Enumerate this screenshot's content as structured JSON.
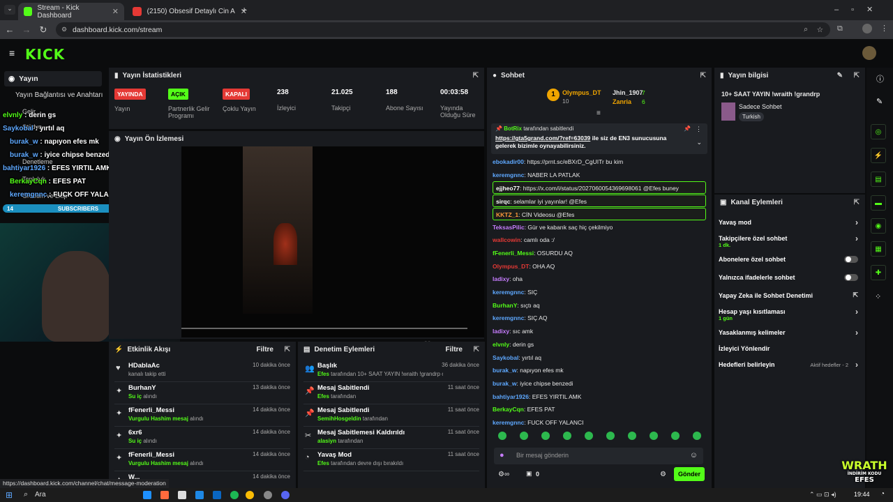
{
  "browser": {
    "tabs": [
      {
        "label": "Stream - Kick Dashboard"
      },
      {
        "label": "(2150) Obsesif Detaylı Cin Alem"
      }
    ],
    "url": "dashboard.kick.com/stream",
    "status_url": "https://dashboard.kick.com/channel/chat/message-moderation"
  },
  "brand": {
    "logo": "KICK",
    "accent": "#53fc18"
  },
  "left_nav": {
    "title": "Yayın",
    "items": [
      "Yayın Bağlantısı ve Anahtarı",
      "Gelir",
      "Stüdyo",
      "Denetleme",
      "Topluluk",
      "Grubum ve Ekip"
    ]
  },
  "stream_stats": {
    "title": "Yayın İstatistikleri",
    "items": [
      {
        "badge": "YAYINDA",
        "label": "Yayın",
        "badge_color": "#e53935"
      },
      {
        "badge": "AÇIK",
        "label": "Partnerlik Gelir Programı",
        "badge_color": "#53fc18"
      },
      {
        "badge": "KAPALI",
        "label": "Çoklu Yayın",
        "badge_color": "#e53935"
      },
      {
        "value": "238",
        "label": "İzleyici"
      },
      {
        "value": "21.025",
        "label": "Takipçi"
      },
      {
        "value": "188",
        "label": "Abone Sayısı"
      },
      {
        "value": "00:03:58",
        "label": "Yayında Olduğu Süre"
      }
    ]
  },
  "preview": {
    "title": "Yayın Ön İzlemesi"
  },
  "activity": {
    "title": "Etkinlik Akışı",
    "filter": "Filtre",
    "rows": [
      {
        "icon": "heart-icon",
        "glyph": "♥",
        "name": "HDablaAc",
        "sub": "kanalı takip etti",
        "hl": "",
        "time": "10 dakika önce"
      },
      {
        "icon": "redeem-icon",
        "glyph": "✦",
        "name": "BurhanY",
        "hl": "Su iç",
        "sub": "alındı",
        "time": "13 dakika önce"
      },
      {
        "icon": "redeem-icon",
        "glyph": "✦",
        "name": "fFenerli_Messi",
        "hl": "Vurgulu Hashim mesaj",
        "sub": "alındı",
        "time": "14 dakika önce"
      },
      {
        "icon": "redeem-icon",
        "glyph": "✦",
        "name": "6xr6",
        "hl": "Su iç",
        "sub": "alındı",
        "time": "14 dakika önce"
      },
      {
        "icon": "redeem-icon",
        "glyph": "✦",
        "name": "fFenerli_Messi",
        "hl": "Vurgulu Hashim mesaj",
        "sub": "alındı",
        "time": "14 dakika önce"
      },
      {
        "icon": "redeem-icon",
        "glyph": "✦",
        "name": "W...",
        "hl": "",
        "sub": "",
        "time": "14 dakika önce"
      }
    ]
  },
  "moderation": {
    "title": "Denetim Eylemleri",
    "filter": "Filtre",
    "rows": [
      {
        "icon": "title-icon",
        "glyph": "👥",
        "name": "Başlık",
        "hl": "Efes",
        "sub": "tarafından 10+ SAAT YAYIN !wraith !grandrp olarak değiştirildi",
        "time": "36 dakika önce"
      },
      {
        "icon": "pin-icon",
        "glyph": "📌",
        "name": "Mesaj Sabitlendi",
        "hl": "Efes",
        "sub": "tarafından",
        "time": "11 saat önce"
      },
      {
        "icon": "pin-icon",
        "glyph": "📌",
        "name": "Mesaj Sabitlendi",
        "hl": "SemihHosgeldin",
        "sub": "tarafından",
        "time": "11 saat önce"
      },
      {
        "icon": "unpin-icon",
        "glyph": "✂",
        "name": "Mesaj Sabitlemesi Kaldırıldı",
        "hl": "alasiyn",
        "sub": "tarafından",
        "time": "11 saat önce"
      },
      {
        "icon": "slow-mode-icon",
        "glyph": "◔",
        "name": "Yavaş Mod",
        "hl": "Efes",
        "sub": "tarafından devre dışı bırakıldı",
        "time": "11 saat önce"
      }
    ]
  },
  "chat": {
    "title": "Sohbet",
    "leaders": [
      {
        "name": "Olympus_DT",
        "count": "10"
      },
      {
        "name": "Jhin_1907",
        "count": "7"
      },
      {
        "name": "Zanria",
        "count": "6"
      }
    ],
    "pinned": {
      "by": "BotRix",
      "by_suffix": "tarafından sabitlendi",
      "link": "https://gta5grand.com/?ref=63039",
      "text": "ile siz de EN3 sunucusuna gelerek bizimle oynayabilirsiniz."
    },
    "messages": [
      {
        "user": "ebokadir00",
        "color": "#5ea8ff",
        "text": "https://prnt.sc/eBXrD_CgUITr bu kim",
        "boxed": false
      },
      {
        "user": "keremgnnc",
        "color": "#5ea8ff",
        "text": "NABER LA PATLAK",
        "boxed": false
      },
      {
        "user": "ejjheo77",
        "color": "#ffffff",
        "text": "https://x.com/i/status/2027060054369698061 @Efes buney",
        "boxed": true
      },
      {
        "user": "sirqc",
        "color": "#ffffff",
        "text": "selamlar iyi yayınlar! @Efes",
        "boxed": true
      },
      {
        "user": "KKTZ_1",
        "color": "#ff9a3c",
        "text": "CİN Videosu @Efes",
        "boxed": true
      },
      {
        "user": "TeksasPilic",
        "color": "#c77dff",
        "text": "Gür ve kabarık saç hiç çekilmiyo",
        "boxed": false
      },
      {
        "user": "wallcowin",
        "color": "#e53935",
        "text": "camlı oda :/",
        "boxed": false
      },
      {
        "user": "fFenerli_Messi",
        "color": "#53fc18",
        "text": "OSURDU AQ",
        "boxed": false
      },
      {
        "user": "Olympus_DT",
        "color": "#e53935",
        "text": "OHA AQ",
        "boxed": false
      },
      {
        "user": "ladixy",
        "color": "#c77dff",
        "text": "oha",
        "boxed": false
      },
      {
        "user": "keremgnnc",
        "color": "#5ea8ff",
        "text": "SIÇ",
        "boxed": false
      },
      {
        "user": "BurhanY",
        "color": "#53fc18",
        "text": "sıçtı aq",
        "boxed": false
      },
      {
        "user": "keremgnnc",
        "color": "#5ea8ff",
        "text": "SIÇ AQ",
        "boxed": false
      },
      {
        "user": "ladixy",
        "color": "#c77dff",
        "text": "sıc amk",
        "boxed": false
      },
      {
        "user": "elvnly",
        "color": "#53fc18",
        "text": "derin gs",
        "boxed": false
      },
      {
        "user": "Saykobal",
        "color": "#5ea8ff",
        "text": "yırtıl aq",
        "boxed": false
      },
      {
        "user": "burak_w",
        "color": "#5ea8ff",
        "text": "napıyon efes mk",
        "boxed": false
      },
      {
        "user": "burak_w",
        "color": "#5ea8ff",
        "text": "iyice chipse benzedi",
        "boxed": false
      },
      {
        "user": "bahtiyar1926",
        "color": "#5ea8ff",
        "text": "EFES YIRTIL AMK",
        "boxed": false
      },
      {
        "user": "BerkayCqn",
        "color": "#53fc18",
        "text": "EFES PAT",
        "boxed": false
      },
      {
        "user": "keremgnnc",
        "color": "#5ea8ff",
        "text": "FUCK OFF YALANCI",
        "boxed": false
      }
    ],
    "input_placeholder": "Bir mesaj gönderin",
    "points": "0",
    "send_label": "Gönder"
  },
  "stream_info": {
    "title": "Yayın bilgisi",
    "stream_title": "10+ SAAT YAYIN !wraith !grandrp",
    "category": "Sadece Sohbet",
    "tag": "Turkish"
  },
  "channel_actions": {
    "title": "Kanal Eylemleri",
    "items": [
      {
        "label": "Yavaş mod",
        "sub": "",
        "control": "chevron"
      },
      {
        "label": "Takipçilere özel sohbet",
        "sub": "1 dk.",
        "control": "chevron"
      },
      {
        "label": "Abonelere özel sohbet",
        "sub": "",
        "control": "toggle"
      },
      {
        "label": "Yalnızca ifadelerle sohbet",
        "sub": "",
        "control": "toggle"
      },
      {
        "label": "Yapay Zeka ile Sohbet Denetimi",
        "sub": "",
        "control": "external"
      },
      {
        "label": "Hesap yaşı kısıtlaması",
        "sub": "1 gün",
        "control": "chevron"
      },
      {
        "label": "Yasaklanmış kelimeler",
        "sub": "",
        "control": "chevron"
      },
      {
        "label": "İzleyici Yönlendir",
        "sub": "",
        "control": ""
      },
      {
        "label": "Hedefleri belirleyin",
        "sub": "",
        "control": "chevron",
        "status": "Aktif hedefler - 2"
      }
    ]
  },
  "overlay": {
    "chat": [
      {
        "user": "elvnly",
        "text": "derin gs"
      },
      {
        "user": "Saykobal",
        "text": "yırtıl aq"
      },
      {
        "user": "burak_w",
        "text": "napıyon efes mk"
      },
      {
        "user": "burak_w",
        "text": "iyice chipse benzedi"
      },
      {
        "user": "bahtiyar1926",
        "text": "EFES YIRTIL AMK"
      },
      {
        "user": "BerkayCqn",
        "text": "EFES PAT"
      },
      {
        "user": "keremgnnc",
        "text": "FUCK OFF YALANCI"
      }
    ],
    "subs_label": "SUBSCRIBERS",
    "subs_left": "14",
    "subs_right": "?",
    "watermark": "WRATH",
    "watermark_sub": "İNDİRİM KODU",
    "watermark_name": "EFES"
  },
  "taskbar": {
    "search": "Ara",
    "time": "19:44"
  }
}
